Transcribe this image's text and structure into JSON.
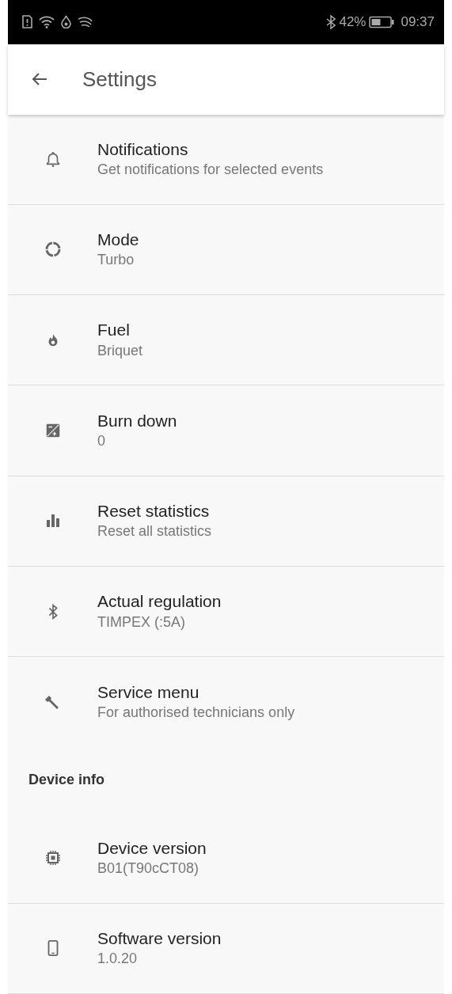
{
  "status_bar": {
    "battery": "42%",
    "time": "09:37"
  },
  "app_bar": {
    "title": "Settings"
  },
  "sections": [
    {
      "items": [
        {
          "title": "Notifications",
          "summary": "Get notifications for selected events"
        },
        {
          "title": "Mode",
          "summary": "Turbo"
        },
        {
          "title": "Fuel",
          "summary": "Briquet"
        },
        {
          "title": "Burn down",
          "summary": "0"
        },
        {
          "title": "Reset statistics",
          "summary": "Reset all statistics"
        },
        {
          "title": "Actual regulation",
          "summary": "TIMPEX (:5A)"
        },
        {
          "title": "Service menu",
          "summary": "For authorised technicians only"
        }
      ]
    },
    {
      "header": "Device info",
      "items": [
        {
          "title": "Device version",
          "summary": "B01(T90cCT08)"
        },
        {
          "title": "Software version",
          "summary": "1.0.20"
        }
      ]
    }
  ]
}
